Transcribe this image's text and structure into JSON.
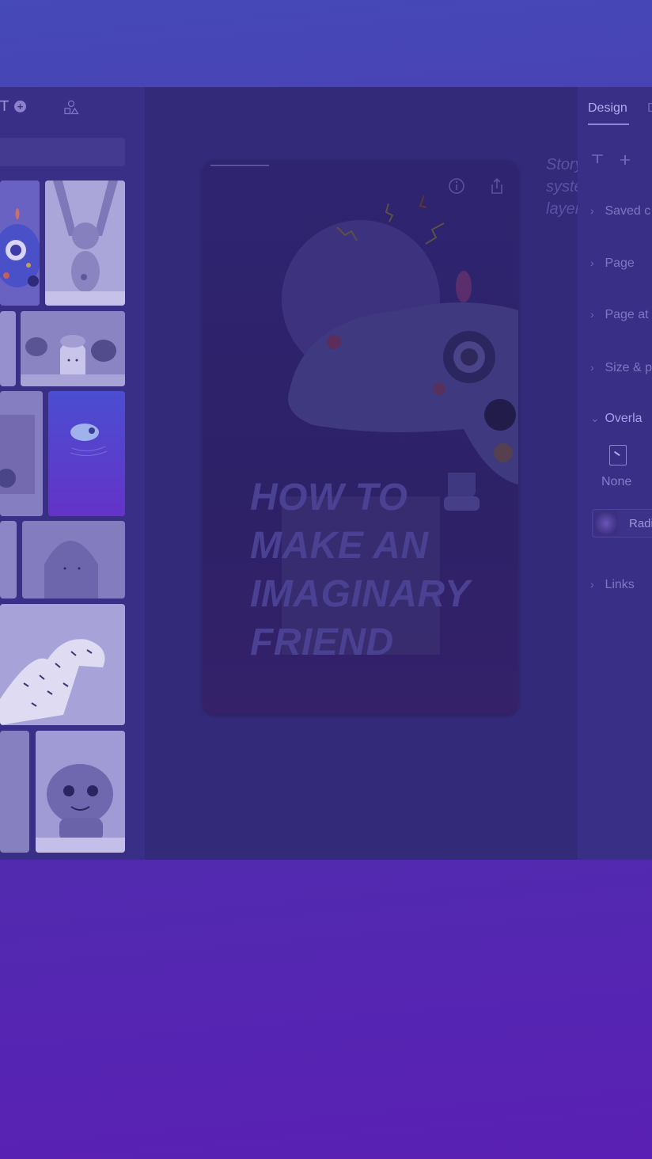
{
  "left_panel": {
    "toolbar": {
      "text_tool": "T",
      "add_symbol": "+"
    },
    "media_tiles": [
      {
        "name": "robot-toy-blue-tile",
        "desc": "blue toy"
      },
      {
        "name": "monkey-wooden-toy-tile",
        "desc": "wooden monkey"
      },
      {
        "name": "partial-tile-1",
        "desc": ""
      },
      {
        "name": "ghost-figurines-tile",
        "desc": ""
      },
      {
        "name": "camera-tile",
        "desc": ""
      },
      {
        "name": "story-thumbnail-tile",
        "desc": ""
      },
      {
        "name": "partial-tile-2",
        "desc": ""
      },
      {
        "name": "blob-toy-tile",
        "desc": ""
      },
      {
        "name": "dinosaur-paper-tile",
        "desc": ""
      },
      {
        "name": "partial-tile-3",
        "desc": ""
      },
      {
        "name": "bulbasaur-toy-tile",
        "desc": ""
      }
    ]
  },
  "canvas": {
    "story": {
      "headline_lines": [
        "HOW TO",
        "MAKE AN",
        "IMAGINARY",
        "FRIEND"
      ]
    },
    "ghost_label_lines": [
      "Story",
      "system",
      "layer"
    ]
  },
  "right_panel": {
    "tabs": {
      "design": "Design",
      "document": "D"
    },
    "sections": {
      "saved": "Saved c",
      "page": "Page",
      "page_attachment": "Page at",
      "size_position": "Size & p",
      "overlay": "Overla",
      "links": "Links"
    },
    "overlay_none": "None",
    "radial_label": "Radi"
  },
  "colors": {
    "background_top": "#4649b8",
    "background_bottom": "#5a1fb4",
    "panel": "#3a2f86",
    "canvas": "#342a7a"
  }
}
